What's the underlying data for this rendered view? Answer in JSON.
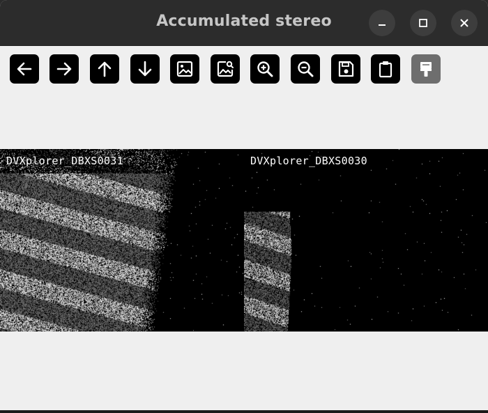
{
  "window": {
    "title": "Accumulated stereo",
    "controls": [
      "minimize-icon",
      "maximize-icon",
      "close-icon"
    ]
  },
  "toolbar": {
    "buttons": [
      {
        "icon": "arrow-left-icon",
        "enabled": true
      },
      {
        "icon": "arrow-right-icon",
        "enabled": true
      },
      {
        "icon": "arrow-up-icon",
        "enabled": true
      },
      {
        "icon": "arrow-down-icon",
        "enabled": true
      },
      {
        "icon": "image-icon",
        "enabled": true
      },
      {
        "icon": "image-search-icon",
        "enabled": true
      },
      {
        "icon": "zoom-in-icon",
        "enabled": true
      },
      {
        "icon": "zoom-out-icon",
        "enabled": true
      },
      {
        "icon": "save-icon",
        "enabled": true
      },
      {
        "icon": "clipboard-icon",
        "enabled": true
      },
      {
        "icon": "paint-brush-icon",
        "enabled": false
      }
    ]
  },
  "viewer": {
    "cameras": [
      {
        "label": "DVXplorer_DBXS0031"
      },
      {
        "label": "DVXplorer_DBXS0030"
      }
    ],
    "colors": {
      "background": "#000000",
      "events": "#ffffff"
    }
  }
}
